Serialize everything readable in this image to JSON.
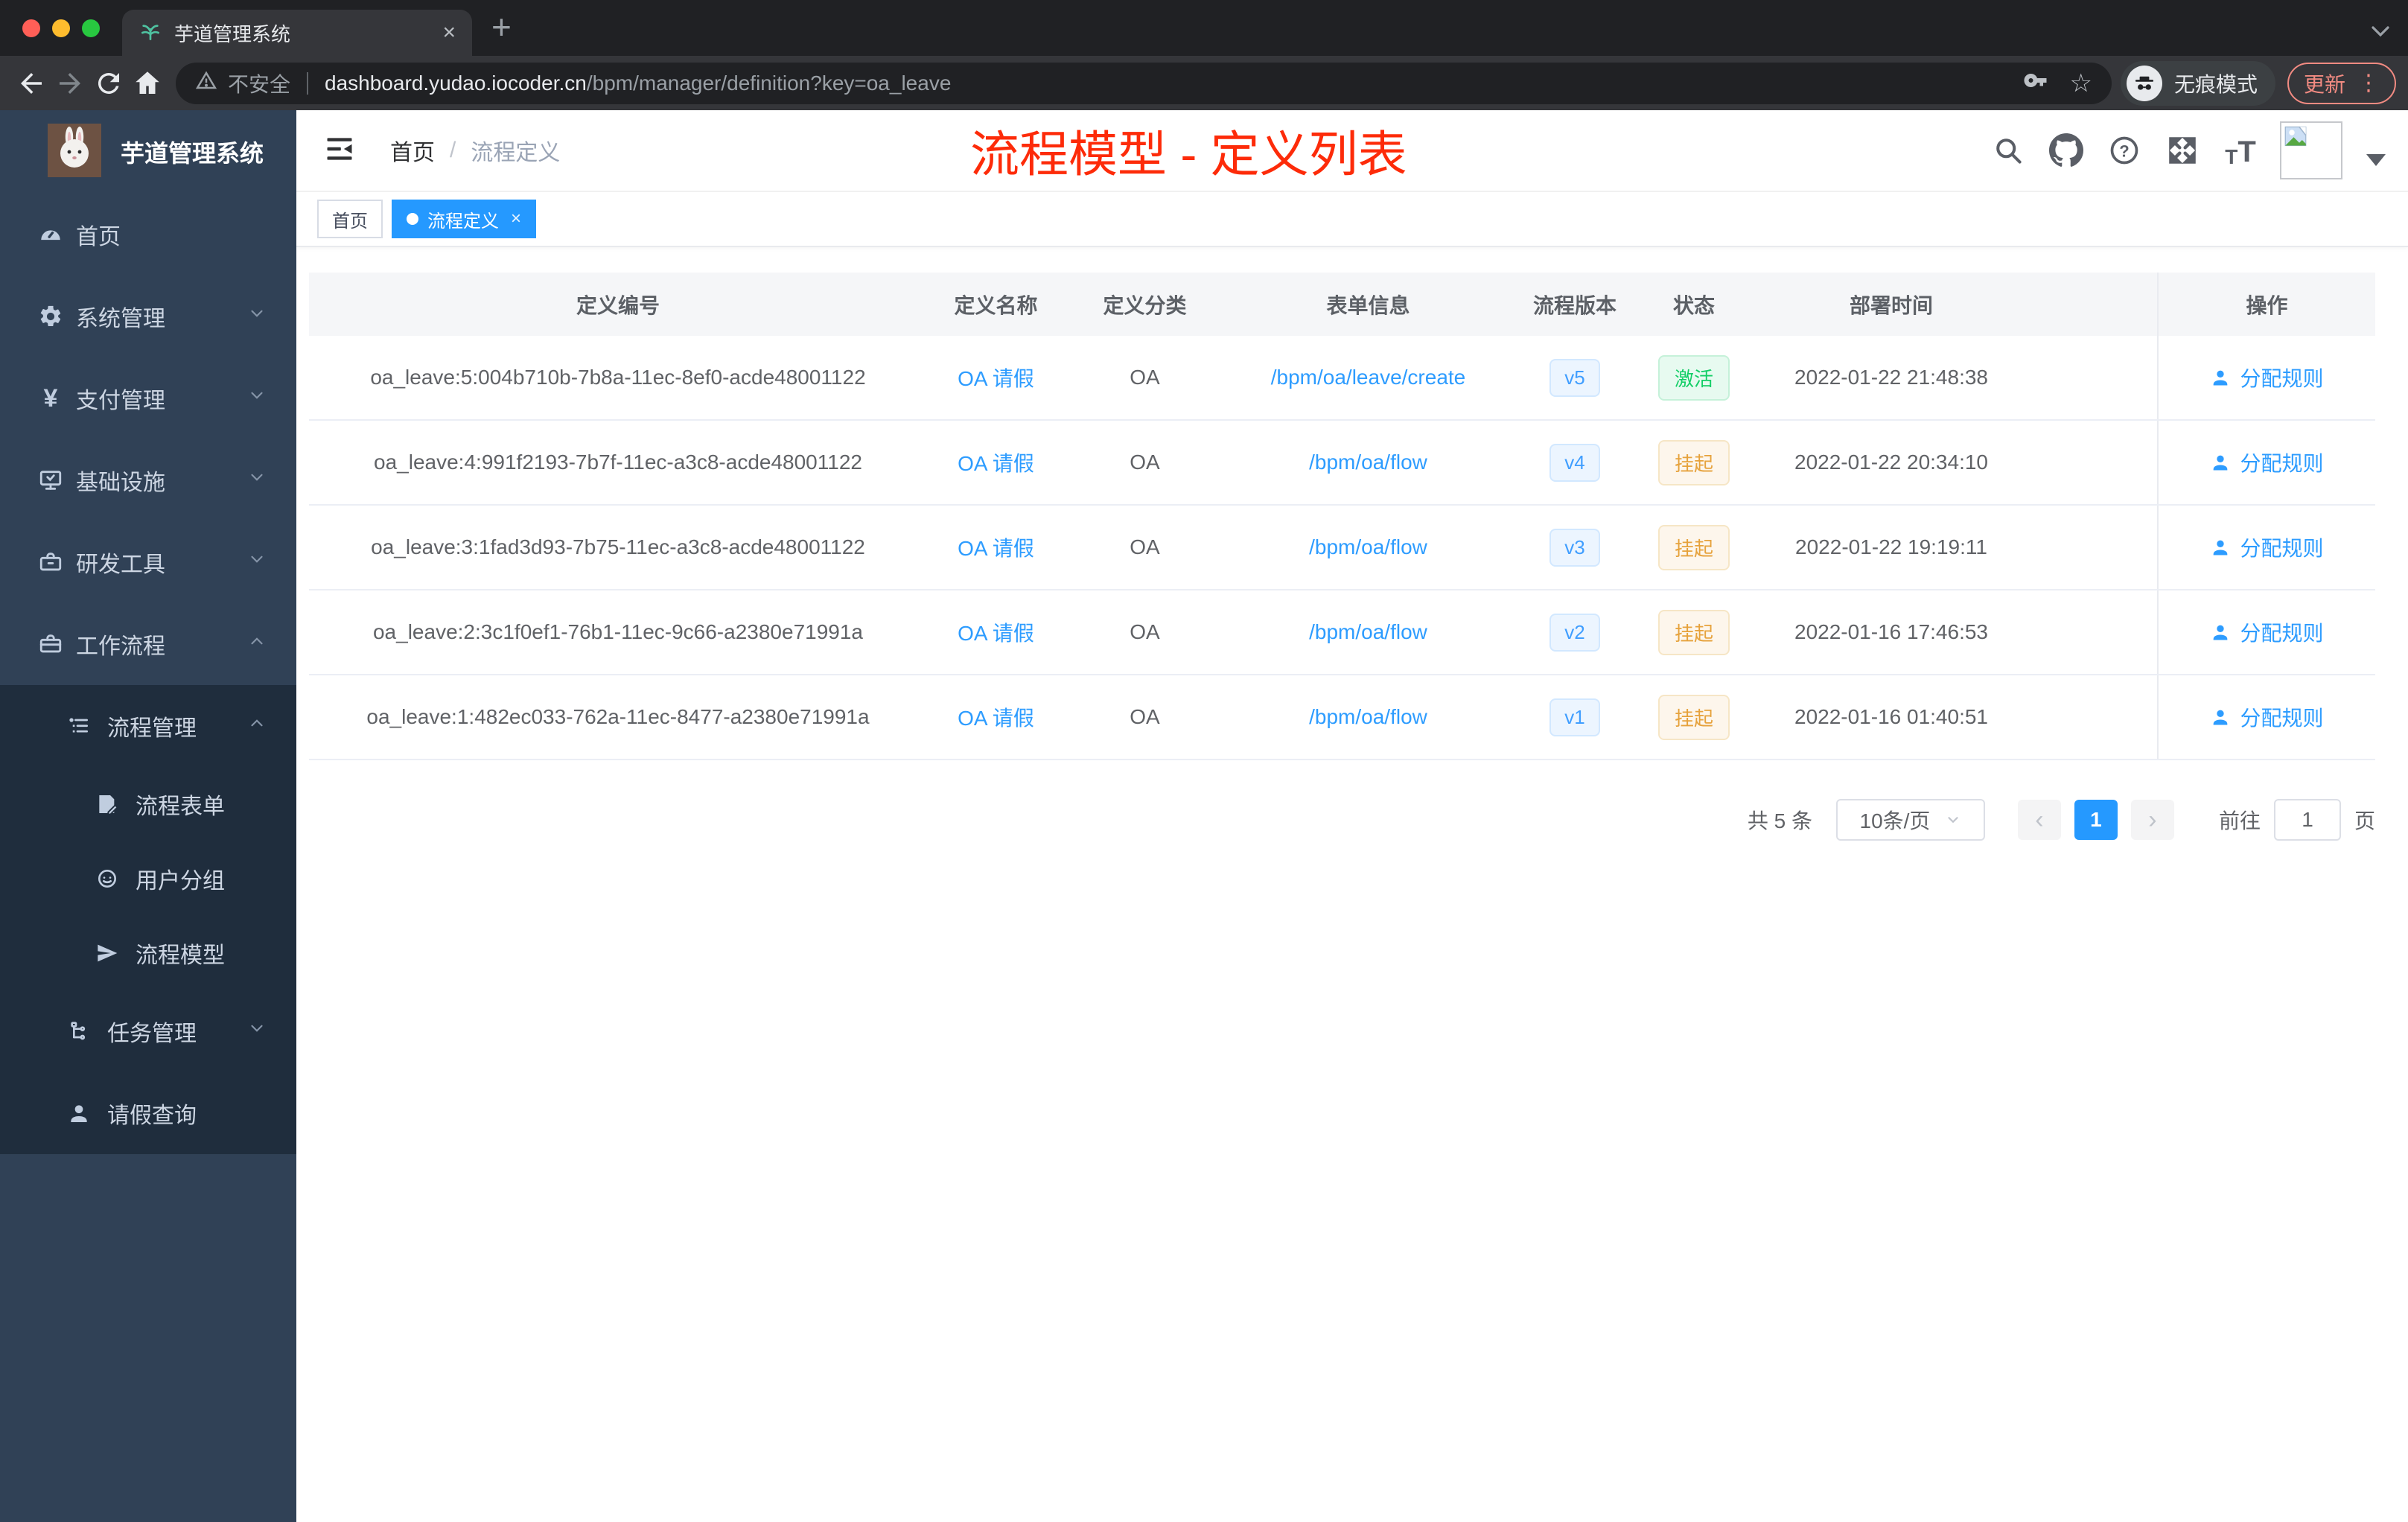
{
  "glyphs": {
    "close": "×",
    "plus": "+",
    "more_vertical": "⋮",
    "star": "☆",
    "question": "?",
    "t_small": "T",
    "t_large": "T",
    "yuan": "¥"
  },
  "browser": {
    "tab_title": "芋道管理系统",
    "security_label": "不安全",
    "url_host": "dashboard.yudao.iocoder.cn",
    "url_path": "/bpm/manager/definition?key=oa_leave",
    "incognito_label": "无痕模式",
    "update_label": "更新"
  },
  "sidebar": {
    "logo_title": "芋道管理系统",
    "items": [
      {
        "label": "首页",
        "icon": "dashboard-icon"
      },
      {
        "label": "系统管理",
        "icon": "gear-icon"
      },
      {
        "label": "支付管理",
        "icon": "yuan-icon"
      },
      {
        "label": "基础设施",
        "icon": "monitor-icon"
      },
      {
        "label": "研发工具",
        "icon": "toolbox-icon"
      },
      {
        "label": "工作流程",
        "icon": "briefcase-icon"
      }
    ],
    "submenu": [
      {
        "label": "流程管理",
        "icon": "list-icon"
      },
      {
        "label": "流程表单",
        "icon": "form-icon"
      },
      {
        "label": "用户分组",
        "icon": "face-icon"
      },
      {
        "label": "流程模型",
        "icon": "paper-plane-icon"
      },
      {
        "label": "任务管理",
        "icon": "tree-icon"
      },
      {
        "label": "请假查询",
        "icon": "user-icon"
      }
    ]
  },
  "header": {
    "breadcrumb": {
      "home": "首页",
      "separator": "/",
      "current": "流程定义"
    },
    "annotation": "流程模型 - 定义列表",
    "annotation_color": "#fd2b09"
  },
  "tags": [
    {
      "label": "首页"
    },
    {
      "label": "流程定义"
    }
  ],
  "table": {
    "columns": [
      "定义编号",
      "定义名称",
      "定义分类",
      "表单信息",
      "流程版本",
      "状态",
      "部署时间",
      "操作"
    ],
    "rows": [
      {
        "id": "oa_leave:5:004b710b-7b8a-11ec-8ef0-acde48001122",
        "name": "OA 请假",
        "category": "OA",
        "form": "/bpm/oa/leave/create",
        "version": "v5",
        "status": "激活",
        "time": "2022-01-22 21:48:38",
        "action": "分配规则"
      },
      {
        "id": "oa_leave:4:991f2193-7b7f-11ec-a3c8-acde48001122",
        "name": "OA 请假",
        "category": "OA",
        "form": "/bpm/oa/flow",
        "version": "v4",
        "status": "挂起",
        "time": "2022-01-22 20:34:10",
        "action": "分配规则"
      },
      {
        "id": "oa_leave:3:1fad3d93-7b75-11ec-a3c8-acde48001122",
        "name": "OA 请假",
        "category": "OA",
        "form": "/bpm/oa/flow",
        "version": "v3",
        "status": "挂起",
        "time": "2022-01-22 19:19:11",
        "action": "分配规则"
      },
      {
        "id": "oa_leave:2:3c1f0ef1-76b1-11ec-9c66-a2380e71991a",
        "name": "OA 请假",
        "category": "OA",
        "form": "/bpm/oa/flow",
        "version": "v2",
        "status": "挂起",
        "time": "2022-01-16 17:46:53",
        "action": "分配规则"
      },
      {
        "id": "oa_leave:1:482ec033-762a-11ec-8477-a2380e71991a",
        "name": "OA 请假",
        "category": "OA",
        "form": "/bpm/oa/flow",
        "version": "v1",
        "status": "挂起",
        "time": "2022-01-16 01:40:51",
        "action": "分配规则"
      }
    ]
  },
  "pagination": {
    "total": "共 5 条",
    "page_size": "10条/页",
    "prev": "‹",
    "next": "›",
    "current_page": "1",
    "goto_label": "前往",
    "goto_value": "1",
    "page_unit": "页"
  },
  "colors": {
    "accent": "#409eff",
    "success": "#13ce66",
    "warning": "#e6a23c",
    "annotation_red": "#fd2b09",
    "sidebar_bg": "#304156",
    "submenu_bg": "#1f2d3d"
  }
}
